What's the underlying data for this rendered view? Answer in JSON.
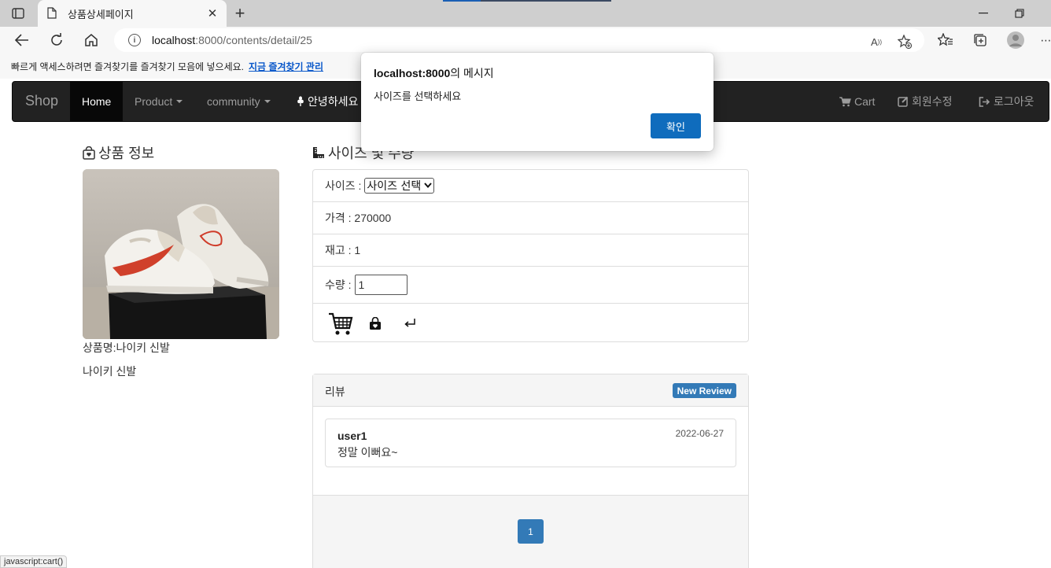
{
  "browser": {
    "tab_title": "상품상세페이지",
    "url_host": "localhost",
    "url_path": ":8000/contents/detail/25",
    "favorites_bar_text": "빠르게 액세스하려면 즐겨찾기를 즐겨찾기 모음에 넣으세요.",
    "favorites_bar_link": "지금 즐겨찾기 관리",
    "status_text": "javascript:cart()"
  },
  "navbar": {
    "brand": "Shop",
    "items": [
      {
        "label": "Home",
        "active": true
      },
      {
        "label": "Product",
        "dropdown": true
      },
      {
        "label": "community",
        "dropdown": true
      },
      {
        "label": "안녕하세요",
        "icon": "wheat-icon"
      }
    ],
    "right_items": [
      {
        "label": "Cart",
        "icon": "cart-icon"
      },
      {
        "label": "회원수정",
        "icon": "edit-icon"
      },
      {
        "label": "로그아웃",
        "icon": "logout-icon"
      }
    ]
  },
  "product": {
    "section_title": "상품 정보",
    "image_alt": "나이키 신발 이미지",
    "name_line": "상품명:나이키 신발",
    "description": "나이키 신발"
  },
  "detail": {
    "section_title": "사이즈 및 수량",
    "size_label": "사이즈 :",
    "size_selected": "사이즈 선택",
    "price_label": "가격 : 270000",
    "stock_label": "재고 : 1",
    "qty_label": "수량 :",
    "qty_value": "1"
  },
  "review": {
    "title": "리뷰",
    "new_review_button": "New Review",
    "items": [
      {
        "user": "user1",
        "date": "2022-06-27",
        "text": "정말 이뻐요~"
      }
    ],
    "pages": [
      "1"
    ]
  },
  "dialog": {
    "title_host": "localhost:8000",
    "title_suffix": "의 메시지",
    "message": "사이즈를 선택하세요",
    "ok_button": "확인",
    "ok_color": "#0f6cbd"
  },
  "colors": {
    "navbar_bg": "#222222",
    "primary": "#337ab7"
  }
}
